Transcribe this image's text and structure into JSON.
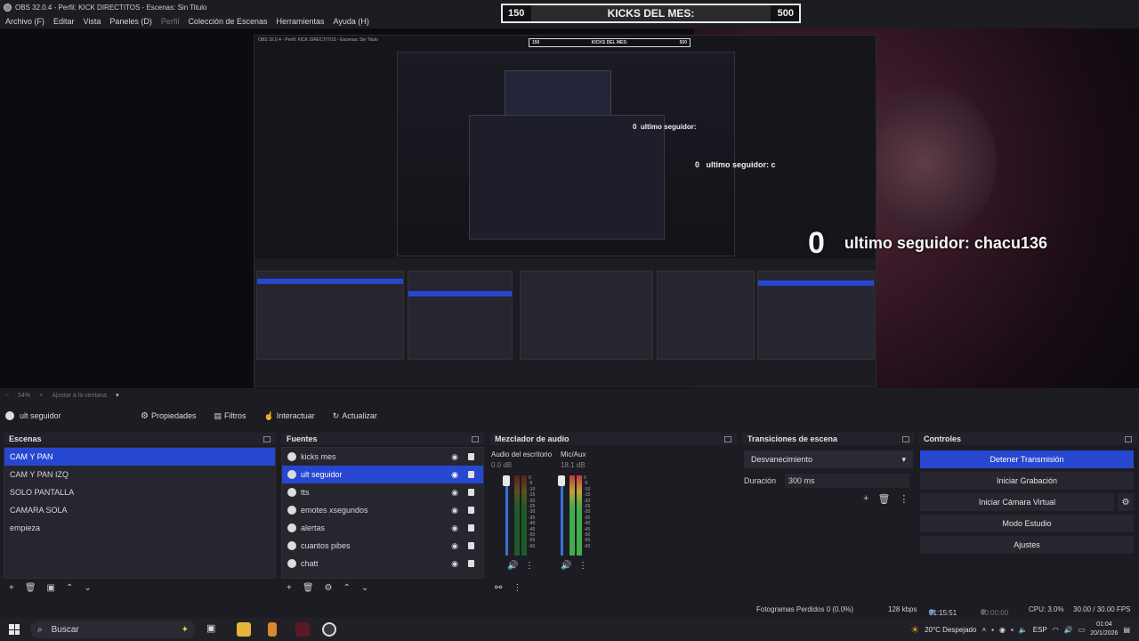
{
  "window": {
    "title": "OBS 32.0.4 - Perfil: KICK DIRECTITOS - Escenas: Sin Titulo"
  },
  "menu": [
    "Archivo (F)",
    "Editar",
    "Vista",
    "Paneles (D)",
    "Perfil",
    "Colección de Escenas",
    "Herramientas",
    "Ayuda (H)"
  ],
  "overlay": {
    "kicks_left": "150",
    "kicks_label": "KICKS DEL MES:",
    "kicks_right": "500",
    "follower_count": "0",
    "follower_text": "ultimo seguidor: chacu136",
    "nested_follower_text": "ultimo seguidor: c",
    "nested_follower_small": "ultimo seguidor:"
  },
  "zoom": {
    "level": "54%",
    "fit_label": "Ajustar a la ventana"
  },
  "source_toolbar": {
    "current_source": "ult seguidor",
    "properties": "Propiedades",
    "filters": "Filtros",
    "interact": "Interactuar",
    "refresh": "Actualizar"
  },
  "scenes": {
    "title": "Escenas",
    "items": [
      "CAM Y PAN",
      "CAM Y PAN IZQ",
      "SOLO PANTALLA",
      "CAMARA SOLA",
      "empieza"
    ],
    "selected": 0
  },
  "sources": {
    "title": "Fuentes",
    "items": [
      "kicks mes",
      "ult seguidor",
      "tts",
      "emotes xsegundos",
      "alertas",
      "cuantos pibes",
      "chatt"
    ],
    "selected": 1
  },
  "mixer": {
    "title": "Mezclador de audio",
    "channels": [
      {
        "name": "Audio del escritorio",
        "db": "0.0 dB",
        "level": 0.0
      },
      {
        "name": "Mic/Aux",
        "db": "18.1 dB",
        "level": 0.7
      }
    ],
    "scale": [
      "0",
      "-5",
      "-10",
      "-15",
      "-20",
      "-25",
      "-30",
      "-35",
      "-40",
      "-45",
      "-50",
      "-55",
      "-60"
    ]
  },
  "transitions": {
    "title": "Transiciones de escena",
    "selected": "Desvanecimiento",
    "duration_label": "Duración",
    "duration_value": "300 ms"
  },
  "controls": {
    "title": "Controles",
    "stop_stream": "Detener Transmisión",
    "start_recording": "Iniciar Grabación",
    "start_virtual_cam": "Iniciar Cámara Virtual",
    "studio_mode": "Modo Estudio",
    "settings": "Ajustes"
  },
  "status": {
    "dropped_frames": "Fotogramas Perdidos 0 (0.0%)",
    "bitrate": "128 kbps",
    "stream_time": "01:15:51",
    "rec_time": "00:00:00",
    "cpu": "CPU: 3.0%",
    "fps": "30.00 / 30.00 FPS"
  },
  "taskbar": {
    "search_placeholder": "Buscar",
    "weather": "20°C  Despejado",
    "language": "ESP",
    "time": "01:04",
    "date": "20/1/2026"
  },
  "colors": {
    "accent": "#2847d1",
    "background": "#1c1c22"
  }
}
